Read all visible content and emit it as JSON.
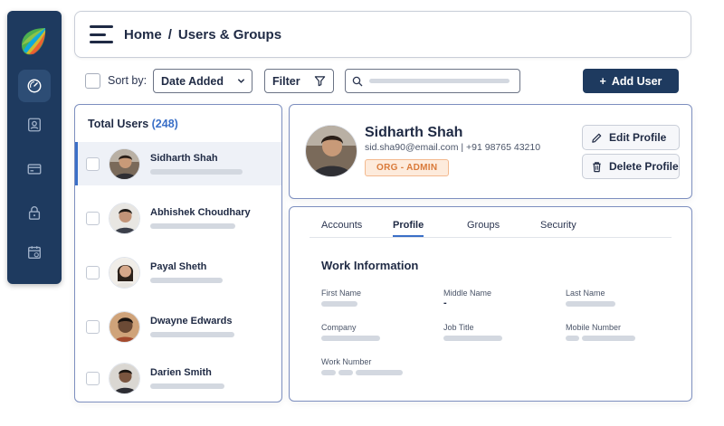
{
  "header": {
    "breadcrumb_home": "Home",
    "breadcrumb_sep": "/",
    "breadcrumb_current": "Users & Groups"
  },
  "sidebar": {
    "icons": [
      "logo-icon",
      "dashboard-icon",
      "user-profile-icon",
      "card-icon",
      "lock-icon",
      "calendar-icon"
    ],
    "active": "dashboard-icon"
  },
  "toolbar": {
    "sort_label": "Sort by:",
    "sort_value": "Date Added",
    "filter_label": "Filter",
    "add_user_label": "Add User",
    "add_user_plus": "+"
  },
  "users": {
    "title": "Total Users",
    "count": "(248)",
    "list": [
      {
        "name": "Sidharth Shah",
        "selected": true
      },
      {
        "name": "Abhishek Choudhary",
        "selected": false
      },
      {
        "name": "Payal Sheth",
        "selected": false
      },
      {
        "name": "Dwayne Edwards",
        "selected": false
      },
      {
        "name": "Darien Smith",
        "selected": false
      }
    ]
  },
  "profile": {
    "name": "Sidharth Shah",
    "contact": "sid.sha90@email.com  |  +91 98765 43210",
    "badge": "ORG - ADMIN",
    "edit_label": "Edit Profile",
    "delete_label": "Delete Profile"
  },
  "details": {
    "tabs": [
      "Accounts",
      "Profile",
      "Groups",
      "Security"
    ],
    "active_tab": "Profile",
    "section_title": "Work Information",
    "fields": {
      "first_name": "First Name",
      "middle_name": "Middle Name",
      "middle_name_value": "-",
      "last_name": "Last Name",
      "company": "Company",
      "job_title": "Job Title",
      "mobile_number": "Mobile Number",
      "work_number": "Work Number"
    }
  },
  "colors": {
    "sidebar": "#1e3a5f",
    "accent": "#3a6fc7",
    "badge": "#d97a3a",
    "panel_border": "#7d8fbf"
  }
}
